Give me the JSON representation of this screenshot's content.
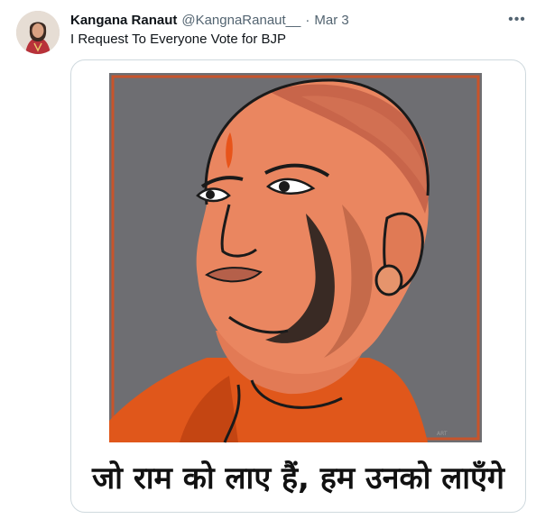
{
  "tweet": {
    "author_name": "Kangana Ranaut",
    "handle": "@KangnaRanaut__",
    "separator": "·",
    "date": "Mar 3",
    "more_label": "•••",
    "text": "I Request To Everyone Vote for BJP",
    "media": {
      "caption": "जो राम को लाए हैं, हम उनको लाएँगे"
    }
  },
  "colors": {
    "poster_background": "#6e6e72",
    "poster_border": "#c8542b",
    "skin": "#ea8660",
    "robe": "#e0571b",
    "tilak": "#e8541a"
  }
}
